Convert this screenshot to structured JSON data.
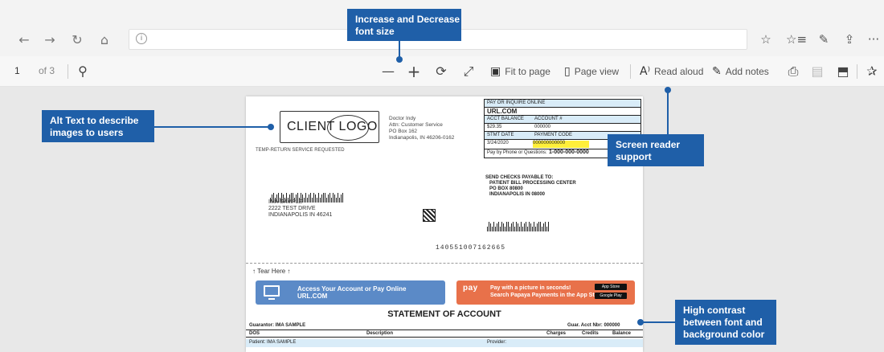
{
  "browser": {
    "nav": {
      "back_icon": "←",
      "forward_icon": "→",
      "refresh_icon": "↻",
      "home_icon": "⌂",
      "info_icon": "i"
    },
    "right_icons": {
      "favorite": "☆",
      "favorites_list": "☆≡",
      "notes": "✎",
      "share": "⇪",
      "more": "···"
    }
  },
  "pdf_toolbar": {
    "page": "1",
    "page_count": "of 3",
    "search_icon": "⚲",
    "zoom_out": "—",
    "zoom_in": "+",
    "rotate": "⟳",
    "fullscreen": "⤢",
    "fit_to_page": "Fit to page",
    "page_view": "Page view",
    "read_aloud": "Read aloud",
    "read_aloud_glyph": "A⁾",
    "add_notes": "Add notes",
    "print_icon": "⎙",
    "save_icon": "▤",
    "save_as_icon": "⬒",
    "pin_icon": "✰"
  },
  "document": {
    "logo_text": "CLIENT LOGO",
    "sender_address": "Doctor Indy\nAttn: Customer Service\nPO Box 162\nIndianapolis, IN 46206-0162",
    "temp_return": "TEMP-RETURN SERVICE REQUESTED",
    "recipient": "IMA SAMPLE\n2222 TEST DRIVE\nINDIANAPOLIS IN 46241",
    "pay_table": {
      "header": "PAY OR INQUIRE ONLINE",
      "url": "URL.COM",
      "acct_balance_label": "ACCT BALANCE",
      "account_label": "ACCOUNT #",
      "balance": "$29.35",
      "account": "000000",
      "stmt_date_label": "STMT DATE",
      "payment_code_label": "PAYMENT CODE",
      "stmt_date": "3/24/2020",
      "payment_code": "000000000000",
      "phone_label": "Pay by Phone or Questions:",
      "phone": "1-000-000-0000"
    },
    "send_checks": "SEND CHECKS PAYABLE TO:\n   PATIENT BILL PROCESSING CENTER\n   PO BOX 80800\n   INDIANAPOLIS IN 08000",
    "id_number": "140551007162665",
    "tear_here": "↑ Tear Here ↑",
    "cta_blue": "Access Your Account or Pay Online\nURL.COM",
    "cta_orange_logo": "pay",
    "cta_orange": "Pay with a picture in seconds!\nSearch Papaya Payments in the App Store",
    "app_store": "App Store",
    "google_play": "Google Play",
    "statement_title": "STATEMENT OF ACCOUNT",
    "guarantor": "Guarantor: IMA SAMPLE",
    "guar_acct": "Guar. Acct Nbr: 000000",
    "columns": {
      "dos": "DOS",
      "description": "Description",
      "charges": "Charges",
      "credits": "Credits",
      "balance": "Balance"
    },
    "row": {
      "patient": "Patient: IMA SAMPLE",
      "provider": "Provider:"
    }
  },
  "callouts": {
    "font_size": "Increase and Decrease\nfont size",
    "alt_text": "Alt Text to describe\nimages to users",
    "screen_reader": "Screen reader\nsupport",
    "contrast": "High contrast\nbetween font and\nbackground color"
  },
  "colors": {
    "callout": "#1f5fa8",
    "highlight": "#ffef3a",
    "table_fill": "#d9ecf8"
  }
}
